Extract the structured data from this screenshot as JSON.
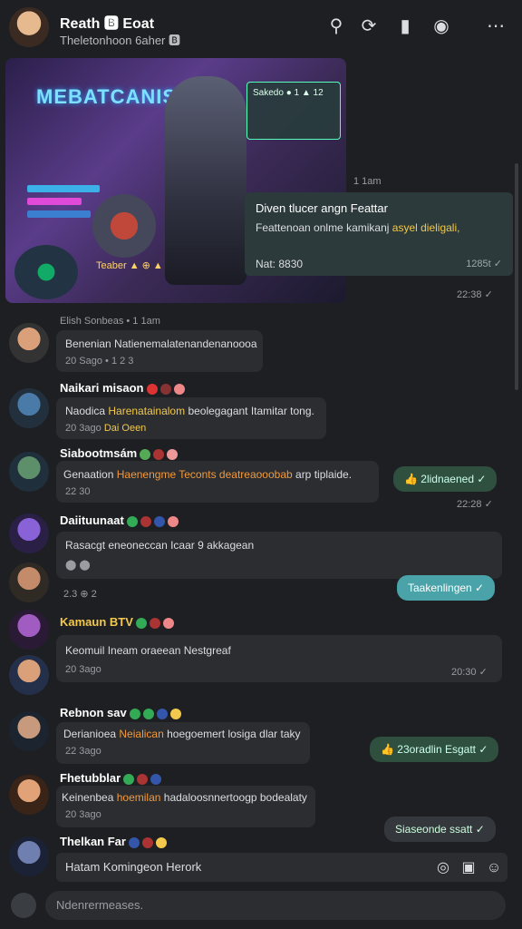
{
  "header": {
    "title": "Reath 🅱 Eoat",
    "subtitle": "Theletonhoon 6aher 🅱"
  },
  "screenshot": {
    "logo_text": "MEBATCANISR",
    "card_text": "Sakedo ● 1 ▲ 12",
    "hud_text": "Teaber ▲ ⊕ ▲"
  },
  "overlay": {
    "title": "Diven tlucer angn Feattar",
    "body_prefix": "Feattenoan onlme kamikanj",
    "body_highlight": "asyel dieligali,",
    "foot": "Nat: 8830",
    "time": "1285t ✓"
  },
  "floating_time_1": "1 1am",
  "floating_time_2": "22:38 ✓",
  "messages": [
    {
      "name": "Elish Sonbeas • 1 1am",
      "text": "Benenian Natienemalatenandenanoooa",
      "meta": "20 Sago • 1 2 3"
    },
    {
      "name": "Naikari misaon",
      "text_a": "Naodica",
      "text_hl": "Harenatainalom",
      "text_b": "beolegagant Itamitar tong.",
      "meta": "20 3ago",
      "meta_hl": "Dai Oeen"
    },
    {
      "name": "Siabootmsám",
      "text_a": "Genaation",
      "text_hl": "Haenengme Teconts deatreaooobab",
      "text_b": "arp tiplaide.",
      "meta": "22 30"
    },
    {
      "name": "Daiituunaat",
      "text": "Rasacgt eneoneccan Icaar 9 akkagean",
      "meta": "⬤ ⬤"
    },
    {
      "name": "Kamaun BTV",
      "text": "Keomuil Ineam oraeean Nestgreaf",
      "meta": "20 3ago"
    },
    {
      "name": "Rebnon sav",
      "text_a": "Derianioea",
      "text_hl": "Neialican",
      "text_b": "hoegoemert losiga dlar taky",
      "meta": "22 3ago"
    },
    {
      "name": "Fhetubblar",
      "text_a": "Keinenbea",
      "text_hl": "hoemilan",
      "text_b": "hadaloosnnertoogp bodealaty",
      "meta": "20 3ago"
    },
    {
      "name": "Thelkan Far"
    }
  ],
  "right_pills": [
    {
      "label": "👍 2lidnaened ✓",
      "time": "22:28 ✓"
    },
    {
      "label": "Taakenlingen ✓",
      "time": ""
    },
    {
      "label": "👍 23oradlin Esgatt ✓",
      "time": ""
    },
    {
      "label": "Siaseonde ssatt ✓",
      "time": ""
    }
  ],
  "inline_time": "20:30 ✓",
  "input": {
    "text": "Hatam Komingeon Herork"
  },
  "compose": {
    "placeholder": "Ndenrermeases."
  }
}
